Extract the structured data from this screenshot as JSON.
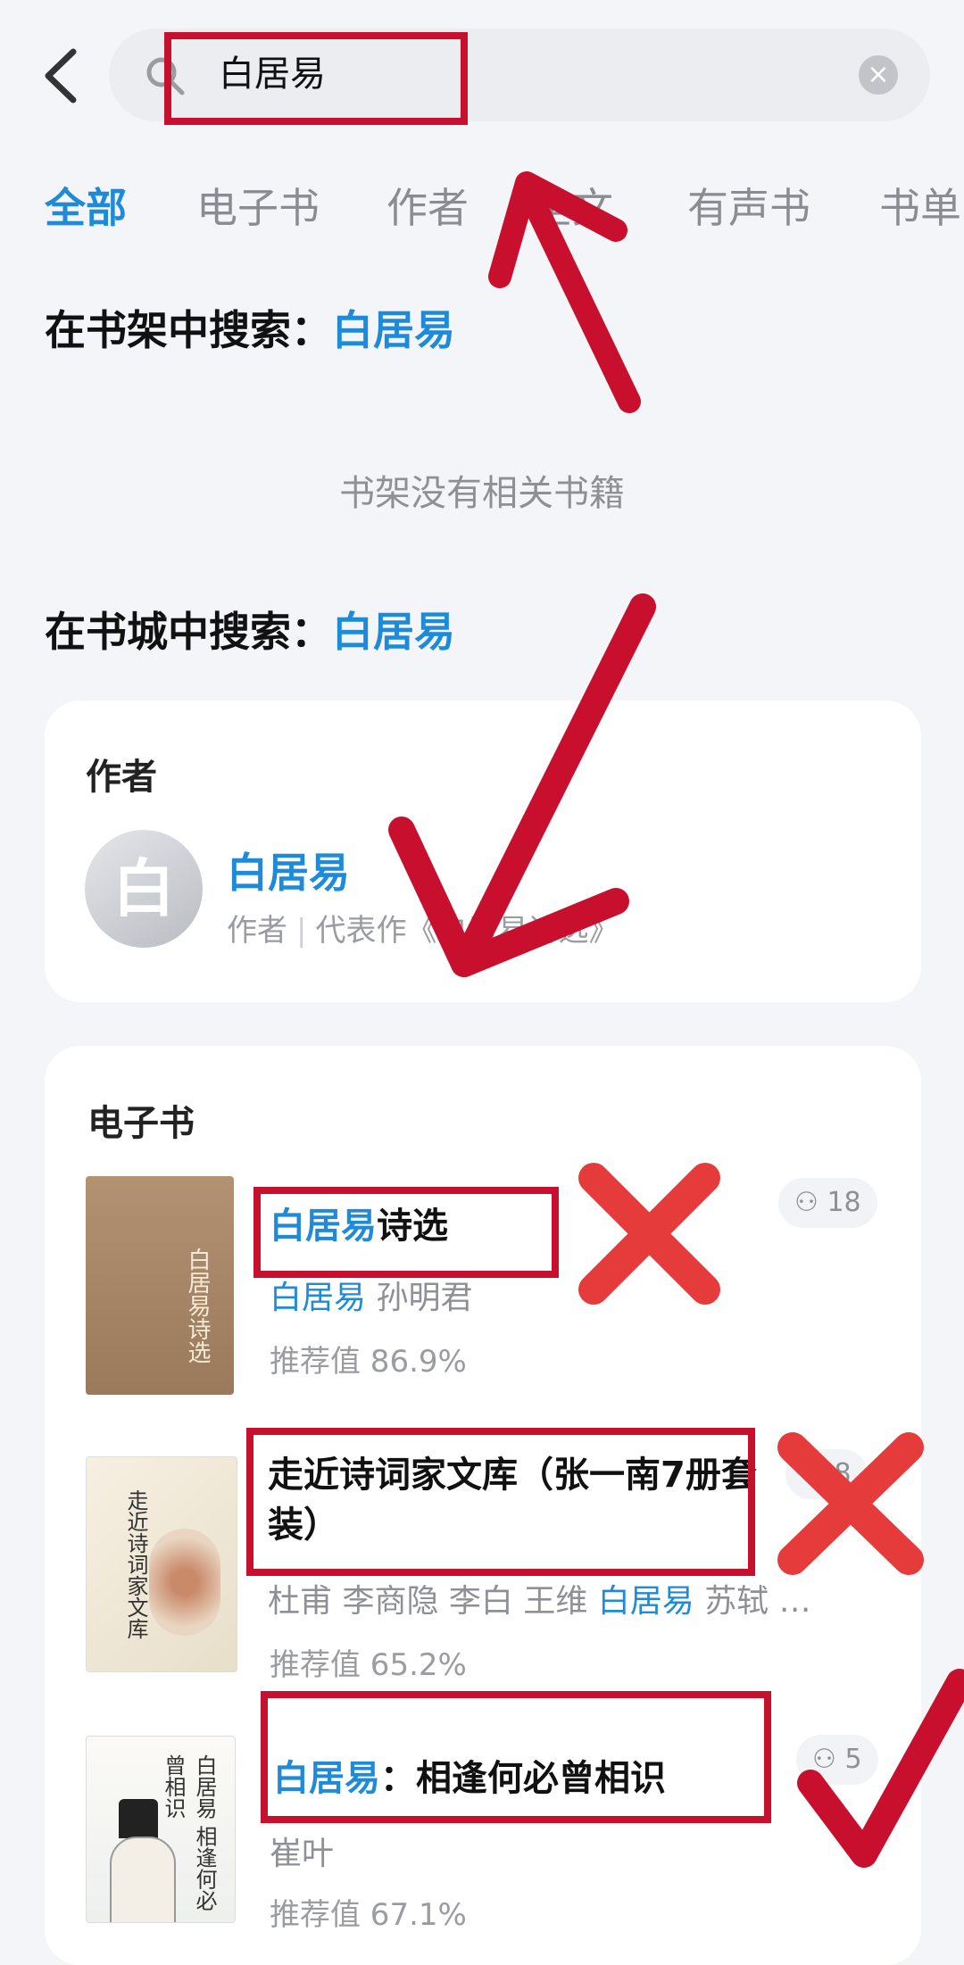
{
  "search": {
    "query": "白居易"
  },
  "tabs": [
    "全部",
    "电子书",
    "作者",
    "全文",
    "有声书",
    "书单"
  ],
  "shelf": {
    "title_prefix": "在书架中搜索：",
    "keyword": "白居易",
    "empty_text": "书架没有相关书籍"
  },
  "store": {
    "title_prefix": "在书城中搜索：",
    "keyword": "白居易"
  },
  "author_card": {
    "heading": "作者",
    "avatar_char": "白",
    "name": "白居易",
    "meta_role": "作者",
    "meta_rest": "代表作《白居易诗选》"
  },
  "ebook_card": {
    "heading": "电子书",
    "books": [
      {
        "title_kw": "白居易",
        "title_rest": "诗选",
        "authors_kw": "白居易",
        "authors_rest": " 孙明君",
        "score": "推荐值 86.9%",
        "readers": "18",
        "cover_text": "白居易诗选"
      },
      {
        "title_rest": "走近诗词家文库（张一南7册套装）",
        "authors_pre": "杜甫 李商隐 李白 王维 ",
        "authors_kw": "白居易",
        "authors_post": " 苏轼 …",
        "score": "推荐值 65.2%",
        "readers": "8",
        "cover_text": "走近诗词家文库"
      },
      {
        "title_kw": "白居易",
        "title_rest": "：相逢何必曾相识",
        "authors_rest": "崔叶",
        "score": "推荐值 67.1%",
        "readers": "5",
        "cover_text": "白居易 相逢何必曾相识"
      }
    ]
  },
  "colors": {
    "accent": "#1f8ad8",
    "annotation_red": "#c8102e",
    "background": "#f4f5f9"
  }
}
